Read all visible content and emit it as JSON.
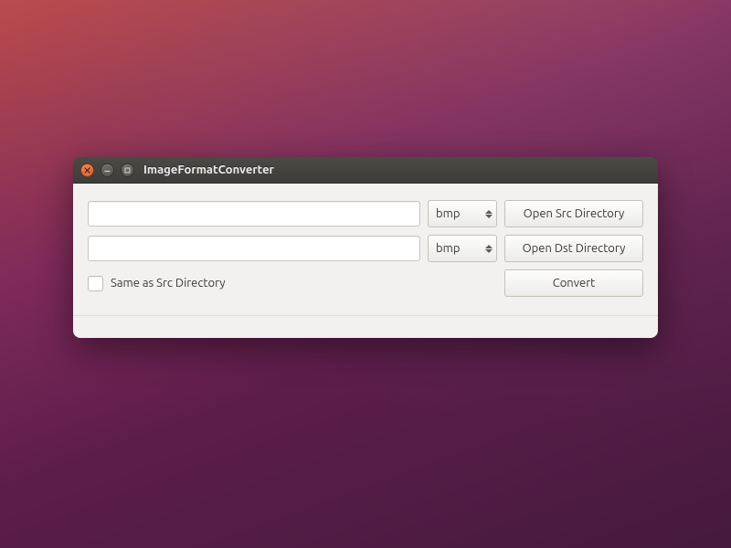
{
  "titlebar": {
    "title": "ImageFormatConverter"
  },
  "rows": {
    "src": {
      "path_value": "",
      "format_selected": "bmp",
      "open_label": "Open Src Directory"
    },
    "dst": {
      "path_value": "",
      "format_selected": "bmp",
      "open_label": "Open Dst Directory"
    }
  },
  "checkbox": {
    "label": "Same as Src Directory",
    "checked": false
  },
  "convert_label": "Convert"
}
